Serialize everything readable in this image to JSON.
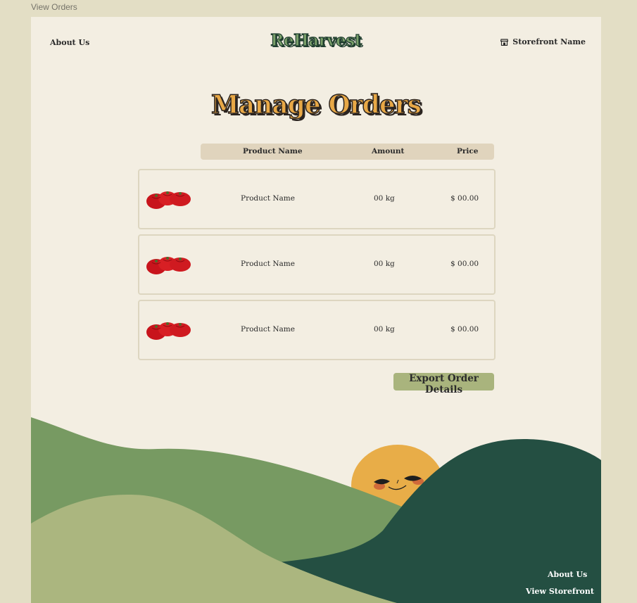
{
  "frame_label": "View Orders",
  "header": {
    "about_label": "About Us",
    "logo_text": "ReHarvest",
    "store_label": "Storefront Name",
    "store_icon": "storefront-icon"
  },
  "main": {
    "title": "Manage Orders",
    "columns": {
      "product": "Product Name",
      "amount": "Amount",
      "price": "Price"
    },
    "orders": [
      {
        "image": "tomatoes-image",
        "product": "Product Name",
        "amount": "00 kg",
        "price": "$ 00.00"
      },
      {
        "image": "tomatoes-image",
        "product": "Product Name",
        "amount": "00 kg",
        "price": "$ 00.00"
      },
      {
        "image": "tomatoes-image",
        "product": "Product Name",
        "amount": "00 kg",
        "price": "$ 00.00"
      }
    ],
    "export_label": "Export Order Details"
  },
  "footer": {
    "about_label": "About Us",
    "storefront_label": "View Storefront"
  },
  "colors": {
    "background": "#e3dec5",
    "page": "#f3eee2",
    "accent_orange": "#e8a846",
    "button": "#a9b47d",
    "hill_mid": "#779a62",
    "hill_light": "#abb67f",
    "hill_dark": "#244f42",
    "sun": "#e8ad48"
  }
}
